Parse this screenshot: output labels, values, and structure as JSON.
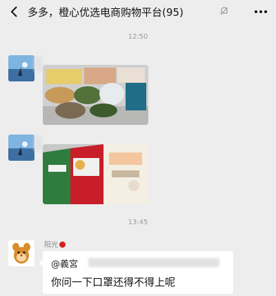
{
  "header": {
    "back_icon": "chevron-left-icon",
    "title": "多多，橙心优选电商购物平台(95)",
    "mute_icon": "bell-muted-icon",
    "more_icon": "ellipsis-icon"
  },
  "messages": [
    {
      "type": "time",
      "text": "12:50"
    },
    {
      "type": "image",
      "content": "grocery-produce-photo"
    },
    {
      "type": "image",
      "content": "boxes-and-rice-bag-photo"
    },
    {
      "type": "time",
      "text": "13:45"
    },
    {
      "type": "text",
      "sender": "阳光",
      "mention": "@義宮",
      "text": "你问一下口罩还得不得上呢"
    }
  ],
  "colors": {
    "background": "#ededed",
    "bubble": "#ffffff",
    "name_dot": "#d42020"
  }
}
